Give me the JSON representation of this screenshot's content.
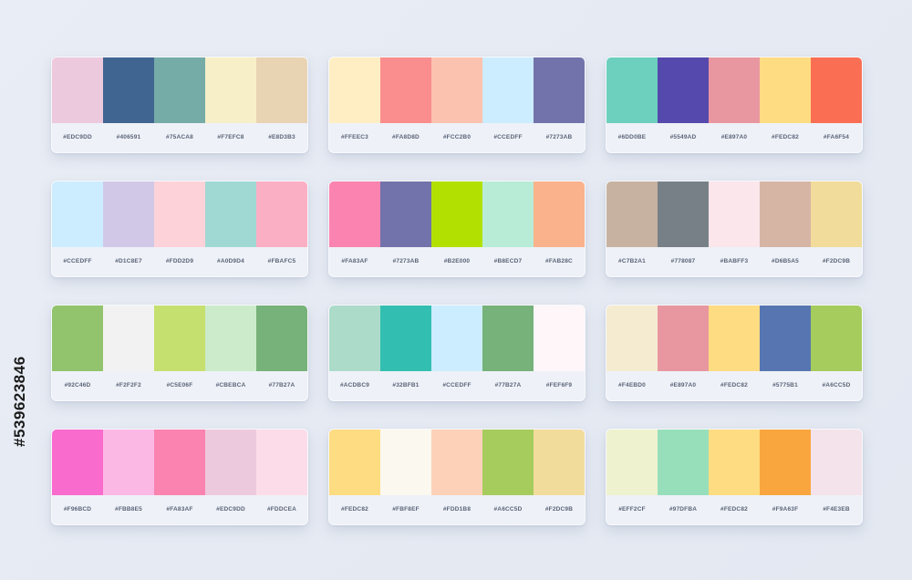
{
  "stock_id": "#539623846",
  "palettes": [
    {
      "colors": [
        "#EDC9DD",
        "#406591",
        "#75ACA8",
        "#F7EFC8",
        "#E8D3B3"
      ],
      "codes": [
        "#EDC9DD",
        "#406591",
        "#75ACA8",
        "#F7EFC8",
        "#E8D3B3"
      ]
    },
    {
      "colors": [
        "#FFEEC3",
        "#FA8D8D",
        "#FCC2B0",
        "#CCEDFF",
        "#7273AB"
      ],
      "codes": [
        "#FFEEC3",
        "#FA8D8D",
        "#FCC2B0",
        "#CCEDFF",
        "#7273AB"
      ]
    },
    {
      "colors": [
        "#6DD0BE",
        "#5549AD",
        "#E897A0",
        "#FEDC82",
        "#FA6F54"
      ],
      "codes": [
        "#6DD0BE",
        "#5549AD",
        "#E897A0",
        "#FEDC82",
        "#FA6F54"
      ]
    },
    {
      "colors": [
        "#CCEDFF",
        "#D1C8E7",
        "#FDD2D9",
        "#A0D9D4",
        "#FBAFC5"
      ],
      "codes": [
        "#CCEDFF",
        "#D1C8E7",
        "#FDD2D9",
        "#A0D9D4",
        "#FBAFC5"
      ]
    },
    {
      "colors": [
        "#FA83AF",
        "#7273AB",
        "#B2E000",
        "#B8ECD7",
        "#FAB28C"
      ],
      "codes": [
        "#FA83AF",
        "#7273AB",
        "#B2E000",
        "#B8ECD7",
        "#FAB28C"
      ]
    },
    {
      "colors": [
        "#C7B2A1",
        "#778087",
        "#FAE6EB",
        "#D6B5A5",
        "#F2DC9B"
      ],
      "codes": [
        "#C7B2A1",
        "#778087",
        "#BABFF3",
        "#D6B5A5",
        "#F2DC9B"
      ]
    },
    {
      "colors": [
        "#92C46D",
        "#F2F2F2",
        "#C5E06F",
        "#CBEBCA",
        "#77B27A"
      ],
      "codes": [
        "#92C46D",
        "#F2F2F2",
        "#C5E06F",
        "#CBEBCA",
        "#77B27A"
      ]
    },
    {
      "colors": [
        "#ACDBC9",
        "#32BFB1",
        "#CCEDFF",
        "#77B27A",
        "#FEF6F9"
      ],
      "codes": [
        "#ACDBC9",
        "#32BFB1",
        "#CCEDFF",
        "#77B27A",
        "#FEF6F9"
      ]
    },
    {
      "colors": [
        "#F4EBD0",
        "#E897A0",
        "#FEDC82",
        "#5775B1",
        "#A6CC5D"
      ],
      "codes": [
        "#F4EBD0",
        "#E897A0",
        "#FEDC82",
        "#5775B1",
        "#A6CC5D"
      ]
    },
    {
      "colors": [
        "#F96BCD",
        "#FBB8E5",
        "#FA83AF",
        "#EDC9DD",
        "#FDDCEA"
      ],
      "codes": [
        "#F96BCD",
        "#FBB8E5",
        "#FA83AF",
        "#EDC9DD",
        "#FDDCEA"
      ]
    },
    {
      "colors": [
        "#FEDC82",
        "#FBF8EF",
        "#FDD1B8",
        "#A6CC5D",
        "#F2DC9B"
      ],
      "codes": [
        "#FEDC82",
        "#FBF8EF",
        "#FDD1B8",
        "#A6CC5D",
        "#F2DC9B"
      ]
    },
    {
      "colors": [
        "#EFF2CF",
        "#97DFBA",
        "#FEDC82",
        "#F9A63F",
        "#F4E3EB"
      ],
      "codes": [
        "#EFF2CF",
        "#97DFBA",
        "#FEDC82",
        "#F9A63F",
        "#F4E3EB"
      ]
    }
  ]
}
